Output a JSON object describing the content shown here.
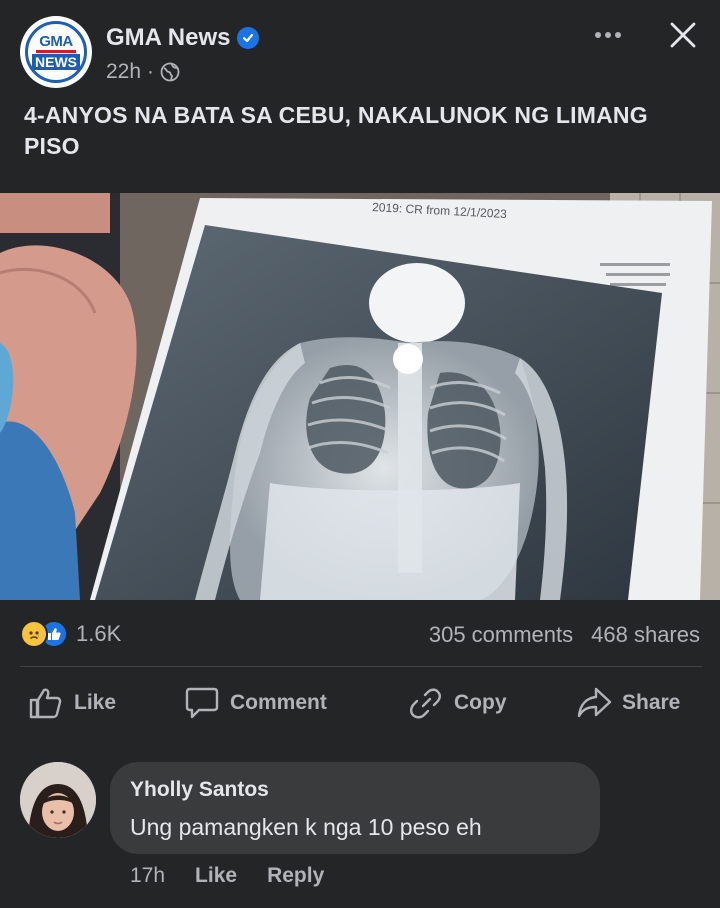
{
  "post": {
    "page_name": "GMA News",
    "time": "22h",
    "separator": "·",
    "text": "4-ANYOS NA BATA SA CEBU, NAKALUNOK NG LIMANG PISO",
    "photo": {
      "paper_caption": "2019: CR from 12/1/2023"
    },
    "logo": {
      "top": "GMA",
      "bottom": "NEWS"
    }
  },
  "stats": {
    "reactions_count": "1.6K",
    "comments": "305 comments",
    "shares": "468 shares"
  },
  "actions": {
    "like": "Like",
    "comment": "Comment",
    "copy": "Copy",
    "share": "Share"
  },
  "comment": {
    "author": "Yholly Santos",
    "text": "Ung pamangken k nga 10 peso eh",
    "time": "17h",
    "like": "Like",
    "reply": "Reply"
  },
  "colors": {
    "background": "#242526",
    "text_primary": "#e4e6eb",
    "text_secondary": "#b0b3b8",
    "verified_blue": "#1b74e4",
    "bubble": "#3a3b3c"
  }
}
